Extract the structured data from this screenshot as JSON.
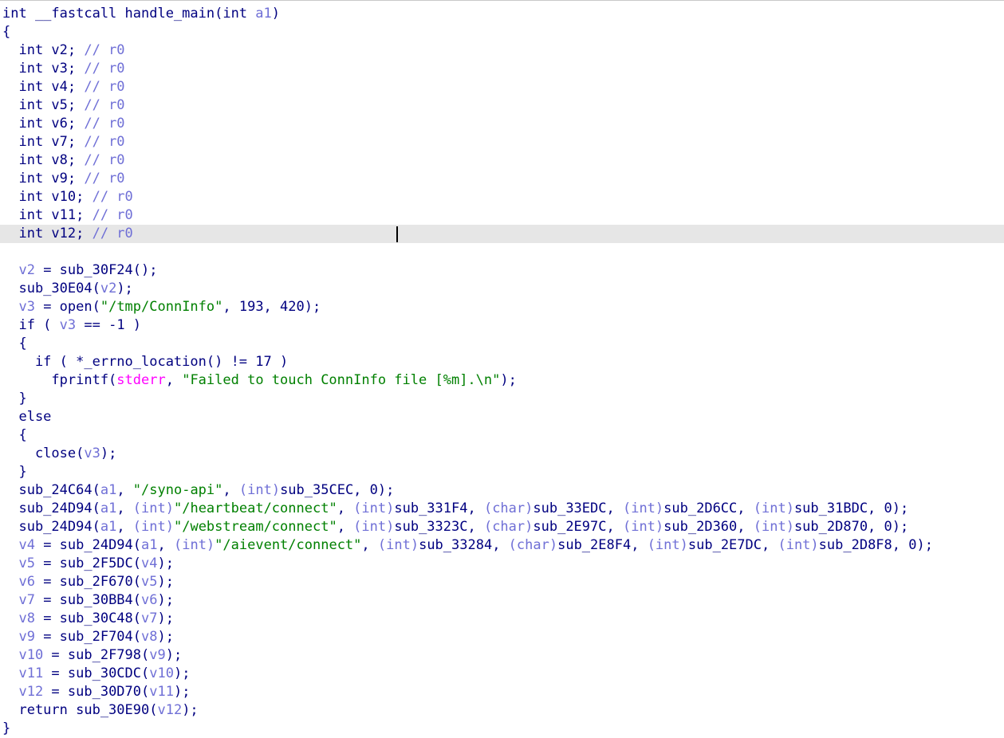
{
  "colors": {
    "keyword": "#000080",
    "local_var": "#6f6fd6",
    "comment": "#6f6fd6",
    "string": "#008000",
    "global": "#ff00ff",
    "highlight_line": "#e6e6e6"
  },
  "current_line": 11,
  "lines": [
    [
      {
        "t": "k",
        "s": "int __fastcall handle_main(int "
      },
      {
        "t": "v",
        "s": "a1"
      },
      {
        "t": "k",
        "s": ")"
      }
    ],
    [
      {
        "t": "k",
        "s": "{"
      }
    ],
    [
      {
        "t": "k",
        "s": "  int v2; "
      },
      {
        "t": "c",
        "s": "// r0"
      }
    ],
    [
      {
        "t": "k",
        "s": "  int v3; "
      },
      {
        "t": "c",
        "s": "// r0"
      }
    ],
    [
      {
        "t": "k",
        "s": "  int v4; "
      },
      {
        "t": "c",
        "s": "// r0"
      }
    ],
    [
      {
        "t": "k",
        "s": "  int v5; "
      },
      {
        "t": "c",
        "s": "// r0"
      }
    ],
    [
      {
        "t": "k",
        "s": "  int v6; "
      },
      {
        "t": "c",
        "s": "// r0"
      }
    ],
    [
      {
        "t": "k",
        "s": "  int v7; "
      },
      {
        "t": "c",
        "s": "// r0"
      }
    ],
    [
      {
        "t": "k",
        "s": "  int v8; "
      },
      {
        "t": "c",
        "s": "// r0"
      }
    ],
    [
      {
        "t": "k",
        "s": "  int v9; "
      },
      {
        "t": "c",
        "s": "// r0"
      }
    ],
    [
      {
        "t": "k",
        "s": "  int v10; "
      },
      {
        "t": "c",
        "s": "// r0"
      }
    ],
    [
      {
        "t": "k",
        "s": "  int v11; "
      },
      {
        "t": "c",
        "s": "// r0"
      }
    ],
    [
      {
        "t": "k",
        "s": "  int v12; "
      },
      {
        "t": "c",
        "s": "// r0"
      }
    ],
    [
      {
        "t": "k",
        "s": ""
      }
    ],
    [
      {
        "t": "v",
        "s": "  v2"
      },
      {
        "t": "k",
        "s": " = sub_30F24();"
      }
    ],
    [
      {
        "t": "k",
        "s": "  sub_30E04("
      },
      {
        "t": "v",
        "s": "v2"
      },
      {
        "t": "k",
        "s": ");"
      }
    ],
    [
      {
        "t": "v",
        "s": "  v3"
      },
      {
        "t": "k",
        "s": " = open("
      },
      {
        "t": "s",
        "s": "\"/tmp/ConnInfo\""
      },
      {
        "t": "k",
        "s": ", 193, 420);"
      }
    ],
    [
      {
        "t": "k",
        "s": "  if ( "
      },
      {
        "t": "v",
        "s": "v3"
      },
      {
        "t": "k",
        "s": " == -1 )"
      }
    ],
    [
      {
        "t": "k",
        "s": "  {"
      }
    ],
    [
      {
        "t": "k",
        "s": "    if ( *_errno_location() != 17 )"
      }
    ],
    [
      {
        "t": "k",
        "s": "      fprintf("
      },
      {
        "t": "g",
        "s": "stderr"
      },
      {
        "t": "k",
        "s": ", "
      },
      {
        "t": "s",
        "s": "\"Failed to touch ConnInfo file [%m].\\n\""
      },
      {
        "t": "k",
        "s": ");"
      }
    ],
    [
      {
        "t": "k",
        "s": "  }"
      }
    ],
    [
      {
        "t": "k",
        "s": "  else"
      }
    ],
    [
      {
        "t": "k",
        "s": "  {"
      }
    ],
    [
      {
        "t": "k",
        "s": "    close("
      },
      {
        "t": "v",
        "s": "v3"
      },
      {
        "t": "k",
        "s": ");"
      }
    ],
    [
      {
        "t": "k",
        "s": "  }"
      }
    ],
    [
      {
        "t": "k",
        "s": "  sub_24C64("
      },
      {
        "t": "v",
        "s": "a1"
      },
      {
        "t": "k",
        "s": ", "
      },
      {
        "t": "s",
        "s": "\"/syno-api\""
      },
      {
        "t": "k",
        "s": ", "
      },
      {
        "t": "v",
        "s": "(int)"
      },
      {
        "t": "k",
        "s": "sub_35CEC, 0);"
      }
    ],
    [
      {
        "t": "k",
        "s": "  sub_24D94("
      },
      {
        "t": "v",
        "s": "a1"
      },
      {
        "t": "k",
        "s": ", "
      },
      {
        "t": "v",
        "s": "(int)"
      },
      {
        "t": "s",
        "s": "\"/heartbeat/connect\""
      },
      {
        "t": "k",
        "s": ", "
      },
      {
        "t": "v",
        "s": "(int)"
      },
      {
        "t": "k",
        "s": "sub_331F4, "
      },
      {
        "t": "v",
        "s": "(char)"
      },
      {
        "t": "k",
        "s": "sub_33EDC, "
      },
      {
        "t": "v",
        "s": "(int)"
      },
      {
        "t": "k",
        "s": "sub_2D6CC, "
      },
      {
        "t": "v",
        "s": "(int)"
      },
      {
        "t": "k",
        "s": "sub_31BDC, 0);"
      }
    ],
    [
      {
        "t": "k",
        "s": "  sub_24D94("
      },
      {
        "t": "v",
        "s": "a1"
      },
      {
        "t": "k",
        "s": ", "
      },
      {
        "t": "v",
        "s": "(int)"
      },
      {
        "t": "s",
        "s": "\"/webstream/connect\""
      },
      {
        "t": "k",
        "s": ", "
      },
      {
        "t": "v",
        "s": "(int)"
      },
      {
        "t": "k",
        "s": "sub_3323C, "
      },
      {
        "t": "v",
        "s": "(char)"
      },
      {
        "t": "k",
        "s": "sub_2E97C, "
      },
      {
        "t": "v",
        "s": "(int)"
      },
      {
        "t": "k",
        "s": "sub_2D360, "
      },
      {
        "t": "v",
        "s": "(int)"
      },
      {
        "t": "k",
        "s": "sub_2D870, 0);"
      }
    ],
    [
      {
        "t": "v",
        "s": "  v4"
      },
      {
        "t": "k",
        "s": " = sub_24D94("
      },
      {
        "t": "v",
        "s": "a1"
      },
      {
        "t": "k",
        "s": ", "
      },
      {
        "t": "v",
        "s": "(int)"
      },
      {
        "t": "s",
        "s": "\"/aievent/connect\""
      },
      {
        "t": "k",
        "s": ", "
      },
      {
        "t": "v",
        "s": "(int)"
      },
      {
        "t": "k",
        "s": "sub_33284, "
      },
      {
        "t": "v",
        "s": "(char)"
      },
      {
        "t": "k",
        "s": "sub_2E8F4, "
      },
      {
        "t": "v",
        "s": "(int)"
      },
      {
        "t": "k",
        "s": "sub_2E7DC, "
      },
      {
        "t": "v",
        "s": "(int)"
      },
      {
        "t": "k",
        "s": "sub_2D8F8, 0);"
      }
    ],
    [
      {
        "t": "v",
        "s": "  v5"
      },
      {
        "t": "k",
        "s": " = sub_2F5DC("
      },
      {
        "t": "v",
        "s": "v4"
      },
      {
        "t": "k",
        "s": ");"
      }
    ],
    [
      {
        "t": "v",
        "s": "  v6"
      },
      {
        "t": "k",
        "s": " = sub_2F670("
      },
      {
        "t": "v",
        "s": "v5"
      },
      {
        "t": "k",
        "s": ");"
      }
    ],
    [
      {
        "t": "v",
        "s": "  v7"
      },
      {
        "t": "k",
        "s": " = sub_30BB4("
      },
      {
        "t": "v",
        "s": "v6"
      },
      {
        "t": "k",
        "s": ");"
      }
    ],
    [
      {
        "t": "v",
        "s": "  v8"
      },
      {
        "t": "k",
        "s": " = sub_30C48("
      },
      {
        "t": "v",
        "s": "v7"
      },
      {
        "t": "k",
        "s": ");"
      }
    ],
    [
      {
        "t": "v",
        "s": "  v9"
      },
      {
        "t": "k",
        "s": " = sub_2F704("
      },
      {
        "t": "v",
        "s": "v8"
      },
      {
        "t": "k",
        "s": ");"
      }
    ],
    [
      {
        "t": "v",
        "s": "  v10"
      },
      {
        "t": "k",
        "s": " = sub_2F798("
      },
      {
        "t": "v",
        "s": "v9"
      },
      {
        "t": "k",
        "s": ");"
      }
    ],
    [
      {
        "t": "v",
        "s": "  v11"
      },
      {
        "t": "k",
        "s": " = sub_30CDC("
      },
      {
        "t": "v",
        "s": "v10"
      },
      {
        "t": "k",
        "s": ");"
      }
    ],
    [
      {
        "t": "v",
        "s": "  v12"
      },
      {
        "t": "k",
        "s": " = sub_30D70("
      },
      {
        "t": "v",
        "s": "v11"
      },
      {
        "t": "k",
        "s": ");"
      }
    ],
    [
      {
        "t": "k",
        "s": "  return sub_30E90("
      },
      {
        "t": "v",
        "s": "v12"
      },
      {
        "t": "k",
        "s": ");"
      }
    ],
    [
      {
        "t": "k",
        "s": "}"
      }
    ]
  ]
}
